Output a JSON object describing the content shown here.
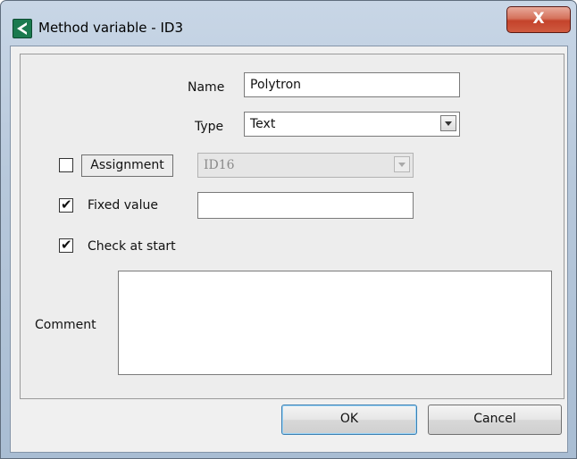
{
  "window": {
    "title": "Method variable - ID3",
    "close_glyph": "X"
  },
  "form": {
    "name_label": "Name",
    "name_value": "Polytron",
    "type_label": "Type",
    "type_value": "Text",
    "assignment_label": "Assignment",
    "assignment_checked": false,
    "assignment_value": "ID16",
    "fixed_value_label": "Fixed value",
    "fixed_value_checked": true,
    "fixed_value_value": "",
    "check_at_start_label": "Check at start",
    "check_at_start_checked": true,
    "comment_label": "Comment",
    "comment_value": ""
  },
  "buttons": {
    "ok": "OK",
    "cancel": "Cancel"
  },
  "icons": {
    "app": "app-logo-icon",
    "close": "close-icon",
    "dropdown": "chevron-down-icon",
    "check": "checkmark-icon"
  },
  "colors": {
    "close_button": "#c4432b",
    "app_icon": "#1b7a4f",
    "title_bar": "#b7c8db"
  }
}
